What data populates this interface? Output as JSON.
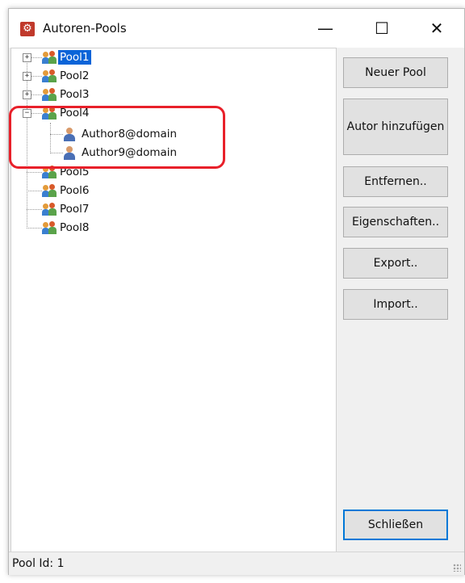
{
  "window": {
    "title": "Autoren-Pools",
    "minimize_glyph": "—",
    "maximize_glyph": "☐",
    "close_glyph": "✕"
  },
  "tree": {
    "pools": [
      {
        "label": "Pool1",
        "expander": "+",
        "selected": true
      },
      {
        "label": "Pool2",
        "expander": "+"
      },
      {
        "label": "Pool3",
        "expander": "+"
      },
      {
        "label": "Pool4",
        "expander": "−",
        "children": [
          "Author8@domain",
          "Author9@domain"
        ]
      },
      {
        "label": "Pool5"
      },
      {
        "label": "Pool6"
      },
      {
        "label": "Pool7"
      },
      {
        "label": "Pool8"
      }
    ]
  },
  "buttons": {
    "new_pool": "Neuer Pool",
    "add_author": "Autor hinzufügen",
    "remove": "Entfernen..",
    "properties": "Eigenschaften..",
    "export": "Export..",
    "import": "Import..",
    "close": "Schließen"
  },
  "status": {
    "text": "Pool Id: 1"
  },
  "colors": {
    "selection": "#0a64d8",
    "highlight_outline": "#e8202a",
    "default_button_border": "#0078d7"
  }
}
